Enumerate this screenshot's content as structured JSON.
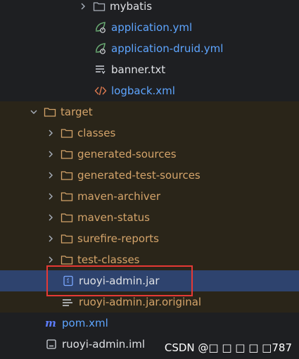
{
  "tree": {
    "items": [
      {
        "label": "mybatis",
        "icon": "folder-icon",
        "expanded": false
      },
      {
        "label": "application.yml",
        "icon": "spring-config-icon"
      },
      {
        "label": "application-druid.yml",
        "icon": "spring-config-icon"
      },
      {
        "label": "banner.txt",
        "icon": "text-file-icon"
      },
      {
        "label": "logback.xml",
        "icon": "xml-file-icon"
      },
      {
        "label": "target",
        "icon": "folder-excluded-icon",
        "expanded": true
      },
      {
        "label": "classes",
        "icon": "folder-excluded-icon",
        "expanded": false
      },
      {
        "label": "generated-sources",
        "icon": "folder-excluded-icon",
        "expanded": false
      },
      {
        "label": "generated-test-sources",
        "icon": "folder-excluded-icon",
        "expanded": false
      },
      {
        "label": "maven-archiver",
        "icon": "folder-excluded-icon",
        "expanded": false
      },
      {
        "label": "maven-status",
        "icon": "folder-excluded-icon",
        "expanded": false
      },
      {
        "label": "surefire-reports",
        "icon": "folder-excluded-icon",
        "expanded": false
      },
      {
        "label": "test-classes",
        "icon": "folder-excluded-icon",
        "expanded": false
      },
      {
        "label": "ruoyi-admin.jar",
        "icon": "jar-archive-icon",
        "selected": true
      },
      {
        "label": "ruoyi-admin.jar.original",
        "icon": "text-lines-icon"
      },
      {
        "label": "pom.xml",
        "icon": "maven-icon"
      },
      {
        "label": "ruoyi-admin.iml",
        "icon": "module-file-icon"
      }
    ]
  },
  "colors": {
    "background": "#1e1f22",
    "target_background": "#2a2519",
    "selection": "#2e436e",
    "highlight_border": "#e53935",
    "excluded_text": "#d4a46a",
    "link_text": "#5ea5ff"
  },
  "watermark": "CSDN @□ □ □ □ □787"
}
